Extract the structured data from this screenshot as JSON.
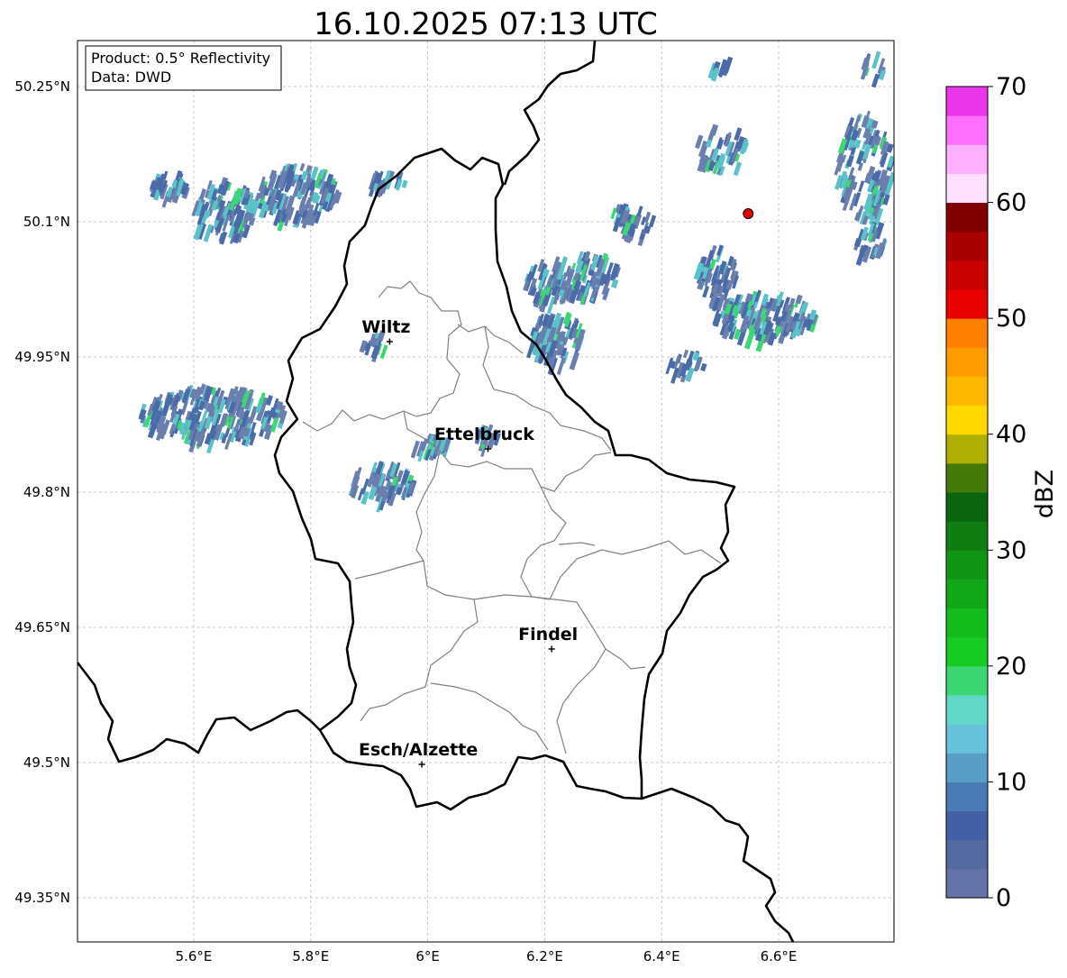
{
  "title": "16.10.2025 07:13 UTC",
  "info_box": {
    "product_line": "Product: 0.5° Reflectivity",
    "data_line": "Data: DWD"
  },
  "axes": {
    "lat_ticks": [
      "50.25°N",
      "50.1°N",
      "49.95°N",
      "49.8°N",
      "49.65°N",
      "49.5°N",
      "49.35°N"
    ],
    "lat_values": [
      50.25,
      50.1,
      49.95,
      49.8,
      49.65,
      49.5,
      49.35
    ],
    "lon_ticks": [
      "5.6°E",
      "5.8°E",
      "6°E",
      "6.2°E",
      "6.4°E",
      "6.6°E"
    ],
    "lon_values": [
      5.6,
      5.8,
      6.0,
      6.2,
      6.4,
      6.6
    ],
    "lon_range": [
      5.4,
      6.8
    ],
    "lat_range": [
      49.3,
      50.3
    ],
    "grid": true
  },
  "places": [
    {
      "name": "Wiltz",
      "lon": 5.935,
      "lat": 49.967
    },
    {
      "name": "Ettelbruck",
      "lon": 6.103,
      "lat": 49.848
    },
    {
      "name": "Findel",
      "lon": 6.212,
      "lat": 49.626
    },
    {
      "name": "Esch/Alzette",
      "lon": 5.99,
      "lat": 49.498
    }
  ],
  "radar_site": {
    "lon": 6.548,
    "lat": 50.109,
    "color": "#e00000"
  },
  "colorbar": {
    "label": "dBZ",
    "min": 0,
    "max": 70,
    "tick_labels": [
      "0",
      "10",
      "20",
      "30",
      "40",
      "50",
      "60",
      "70"
    ],
    "colors": [
      "#6472a8",
      "#54699f",
      "#4360a4",
      "#4a7ab4",
      "#5a9ec8",
      "#68c2dc",
      "#62d8c8",
      "#3dd675",
      "#16cc22",
      "#14bb1c",
      "#12a718",
      "#109414",
      "#0f7d12",
      "#0a6410",
      "#437a0a",
      "#afaf05",
      "#ffd800",
      "#ffb900",
      "#ff9d00",
      "#ff7f00",
      "#e80000",
      "#c80000",
      "#a80000",
      "#800000",
      "#ffe0ff",
      "#ffb0ff",
      "#ff70ff",
      "#ea36ea"
    ]
  },
  "echo_colors": {
    "light": "#6a7fae",
    "medium": "#4a6aa8",
    "strong": "#5ac2c8",
    "peak": "#3dd675"
  }
}
